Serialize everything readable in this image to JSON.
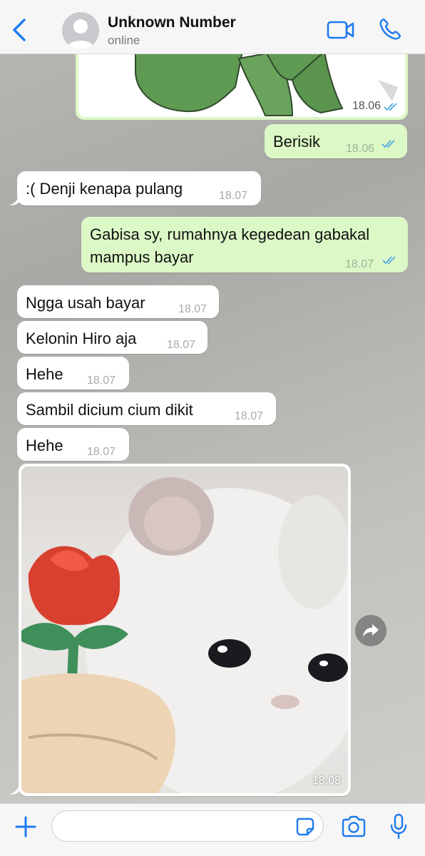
{
  "header": {
    "contact_name": "Unknown Number",
    "status": "online"
  },
  "messages": [
    {
      "id": "m0",
      "direction": "out",
      "type": "sticker",
      "time": "18.06",
      "read": true
    },
    {
      "id": "m1",
      "direction": "out",
      "text": "Berisik",
      "time": "18.06",
      "read": true
    },
    {
      "id": "m2",
      "direction": "in",
      "text": ":( Denji kenapa pulang",
      "time": "18.07"
    },
    {
      "id": "m3",
      "direction": "out",
      "text_line1": "Gabisa sy, rumahnya kegedean gabakal",
      "text_line2": "mampus bayar",
      "time": "18.07",
      "read": true
    },
    {
      "id": "m4",
      "direction": "in",
      "text": "Ngga usah bayar",
      "time": "18.07"
    },
    {
      "id": "m5",
      "direction": "in",
      "text": "Kelonin Hiro aja",
      "time": "18.07"
    },
    {
      "id": "m6",
      "direction": "in",
      "text": "Hehe",
      "time": "18.07"
    },
    {
      "id": "m7",
      "direction": "in",
      "text": "Sambil dicium cium dikit",
      "time": "18.07"
    },
    {
      "id": "m8",
      "direction": "in",
      "text": "Hehe",
      "time": "18.07"
    },
    {
      "id": "m9",
      "direction": "in",
      "type": "image",
      "time": "18.08"
    }
  ],
  "composer": {
    "placeholder": ""
  },
  "colors": {
    "accent": "#1f7bef",
    "outgoing_bubble": "#dcf8c6",
    "incoming_bubble": "#ffffff",
    "read_ticks": "#4fa8e6"
  },
  "icons": [
    "chevron-left-icon",
    "avatar-placeholder-icon",
    "video-icon",
    "phone-icon",
    "forward-icon",
    "plus-icon",
    "sticker-icon",
    "camera-icon",
    "microphone-icon",
    "double-check-icon"
  ]
}
